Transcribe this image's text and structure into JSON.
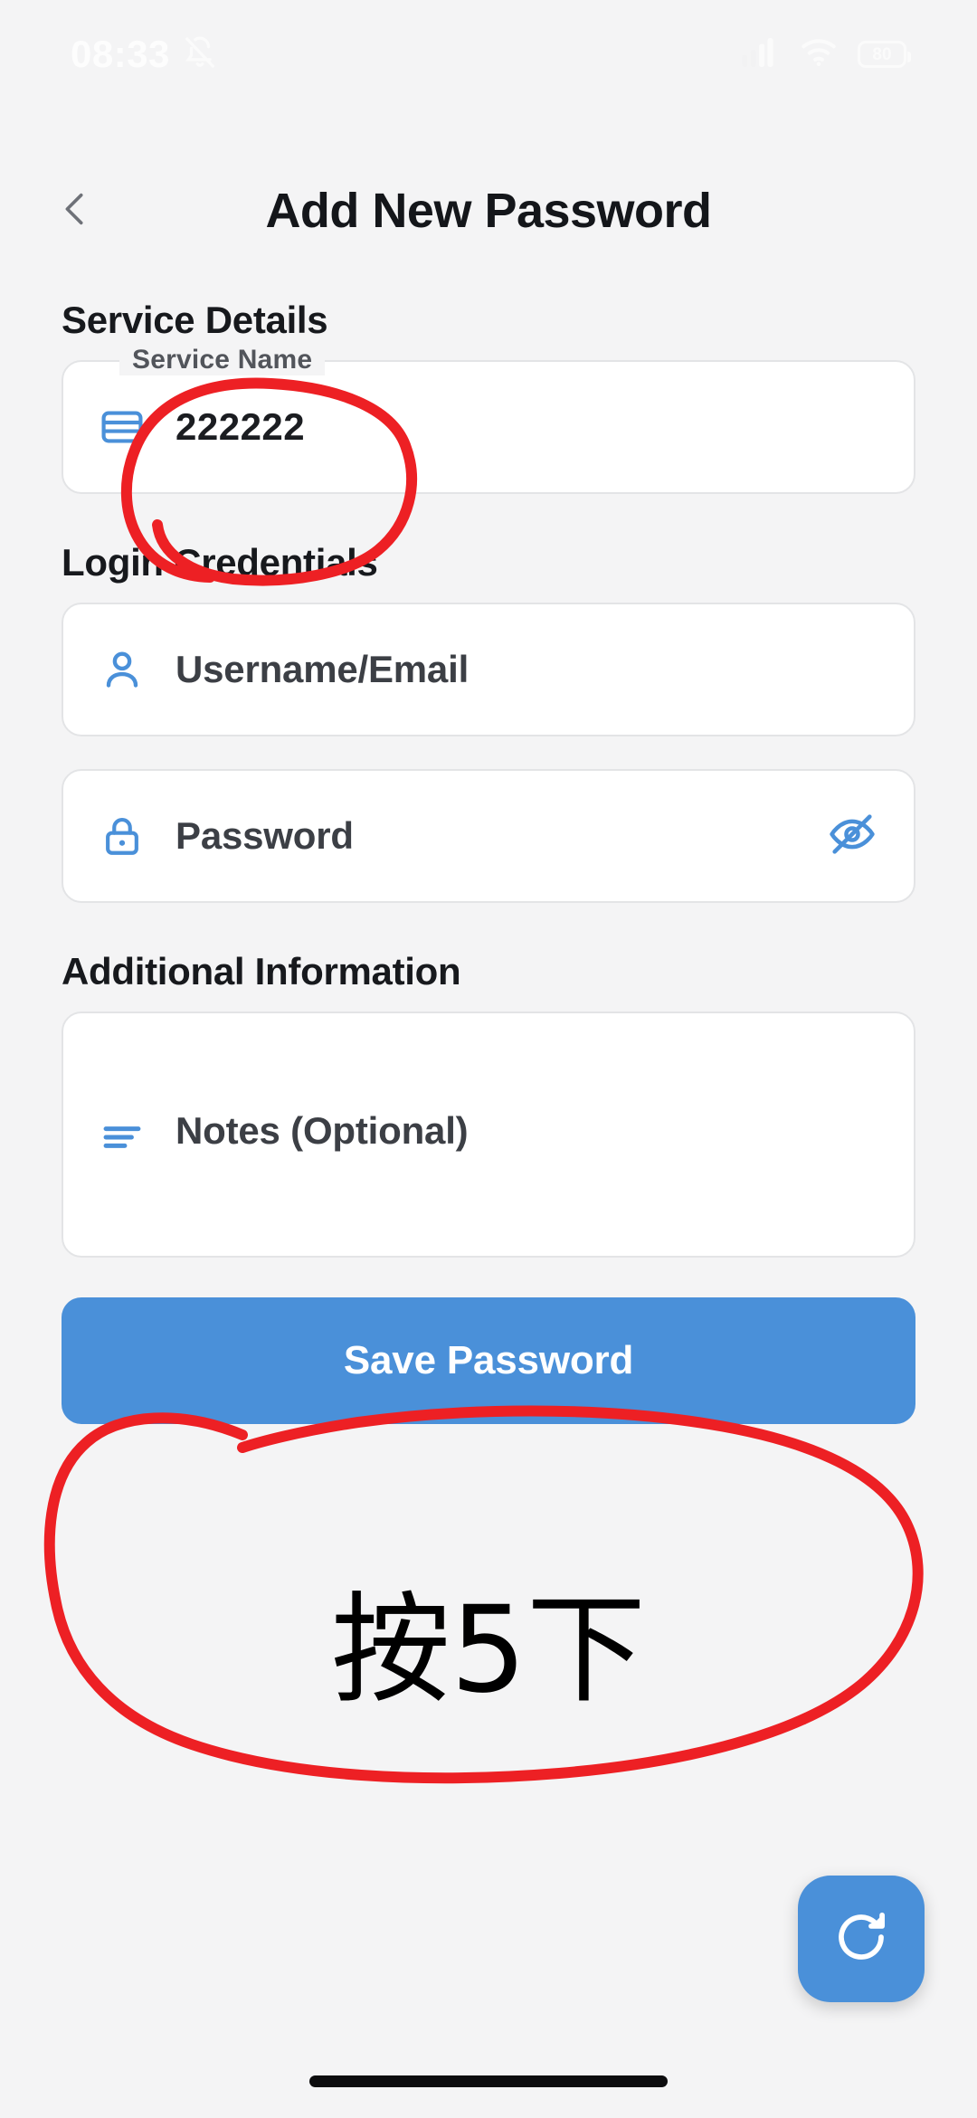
{
  "status_bar": {
    "time": "08:33",
    "bell_icon": "bell-muted-icon",
    "signal_icon": "cellular-signal-icon",
    "wifi_icon": "wifi-icon",
    "battery_level": "80"
  },
  "header": {
    "back_icon": "chevron-left-icon",
    "title": "Add New Password"
  },
  "sections": {
    "service": {
      "title": "Service Details",
      "field": {
        "label": "Service Name",
        "value": "222222",
        "icon": "credit-card-icon"
      }
    },
    "login": {
      "title": "Login Credentials",
      "username": {
        "placeholder": "Username/Email",
        "value": "",
        "icon": "person-icon"
      },
      "password": {
        "placeholder": "Password",
        "value": "",
        "icon": "lock-icon",
        "toggle_icon": "eye-off-icon"
      }
    },
    "additional": {
      "title": "Additional Information",
      "notes": {
        "placeholder": "Notes (Optional)",
        "value": "",
        "icon": "notes-lines-icon"
      }
    }
  },
  "actions": {
    "save_label": "Save Password",
    "fab_icon": "refresh-icon"
  },
  "annotations": {
    "note_text": "按5下",
    "ink_color": "#ed2024"
  },
  "colors": {
    "background": "#f4f4f5",
    "card": "#ffffff",
    "border": "#e3e4e6",
    "accent_blue": "#4a90d9",
    "icon_blue": "#4a90d9",
    "text_primary": "#17191d",
    "text_secondary": "#3c3f45",
    "label": "#52555b"
  }
}
